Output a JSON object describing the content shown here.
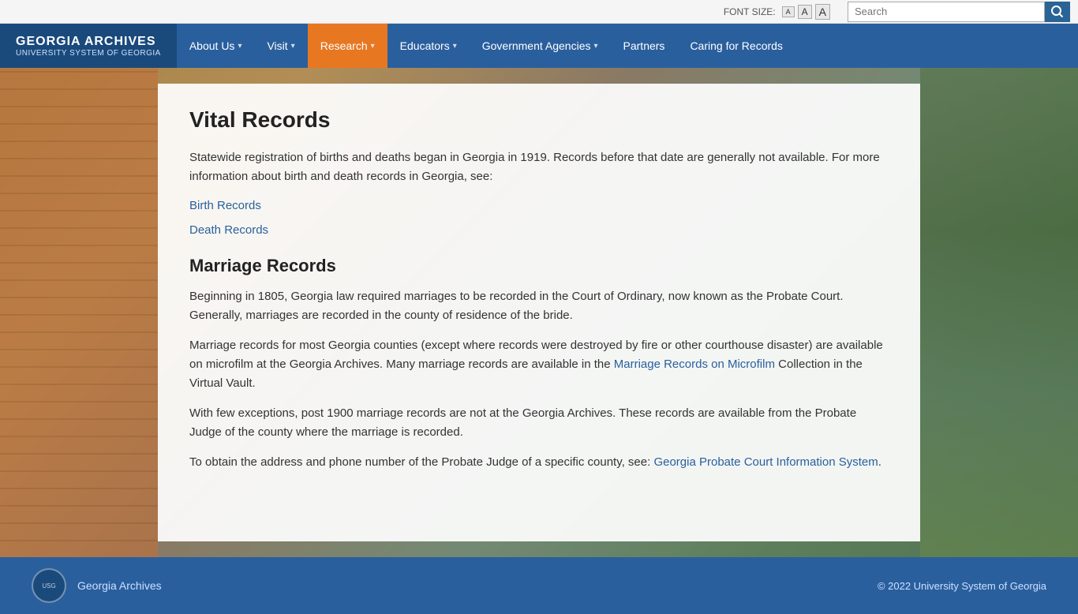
{
  "topbar": {
    "font_size_label": "FONT SIZE:",
    "font_small": "A",
    "font_medium": "A",
    "font_large": "A",
    "search_placeholder": "Search"
  },
  "nav": {
    "logo_title": "GEORGIA ARCHIVES",
    "logo_subtitle": "UNIVERSITY SYSTEM OF GEORGIA",
    "items": [
      {
        "label": "About Us",
        "has_dropdown": true,
        "active": false
      },
      {
        "label": "Visit",
        "has_dropdown": true,
        "active": false
      },
      {
        "label": "Research",
        "has_dropdown": true,
        "active": true
      },
      {
        "label": "Educators",
        "has_dropdown": true,
        "active": false
      },
      {
        "label": "Government Agencies",
        "has_dropdown": true,
        "active": false
      },
      {
        "label": "Partners",
        "has_dropdown": false,
        "active": false
      },
      {
        "label": "Caring for Records",
        "has_dropdown": false,
        "active": false
      }
    ]
  },
  "main": {
    "page_title": "Vital Records",
    "intro_paragraph": "Statewide registration of births and deaths began in Georgia in 1919. Records before that date are generally not available. For more information about birth and death records in Georgia, see:",
    "links": [
      {
        "label": "Birth Records",
        "href": "#"
      },
      {
        "label": "Death Records",
        "href": "#"
      }
    ],
    "section2_title": "Marriage Records",
    "paragraph1": "Beginning in 1805, Georgia law required marriages to be recorded in the Court of Ordinary, now known as the Probate Court. Generally, marriages are recorded in the county of residence of the bride.",
    "paragraph2_before": "Marriage records for most Georgia counties (except where records were destroyed by fire or other courthouse disaster) are available on microfilm at the Georgia Archives. Many marriage records are available in the ",
    "paragraph2_link": "Marriage Records on Microfilm",
    "paragraph2_after": " Collection in the Virtual Vault.",
    "paragraph3": "With few exceptions, post 1900 marriage records are not at the Georgia Archives. These records are available from the Probate Judge of the county where the marriage is recorded.",
    "paragraph4_before": "To obtain the address and phone number of the Probate Judge of a specific county, see: ",
    "paragraph4_link": "Georgia Probate Court Information System",
    "paragraph4_after": "."
  },
  "footer": {
    "org_name": "Georgia Archives",
    "logo_text": "USG",
    "copyright": "© 2022 University System of Georgia"
  }
}
